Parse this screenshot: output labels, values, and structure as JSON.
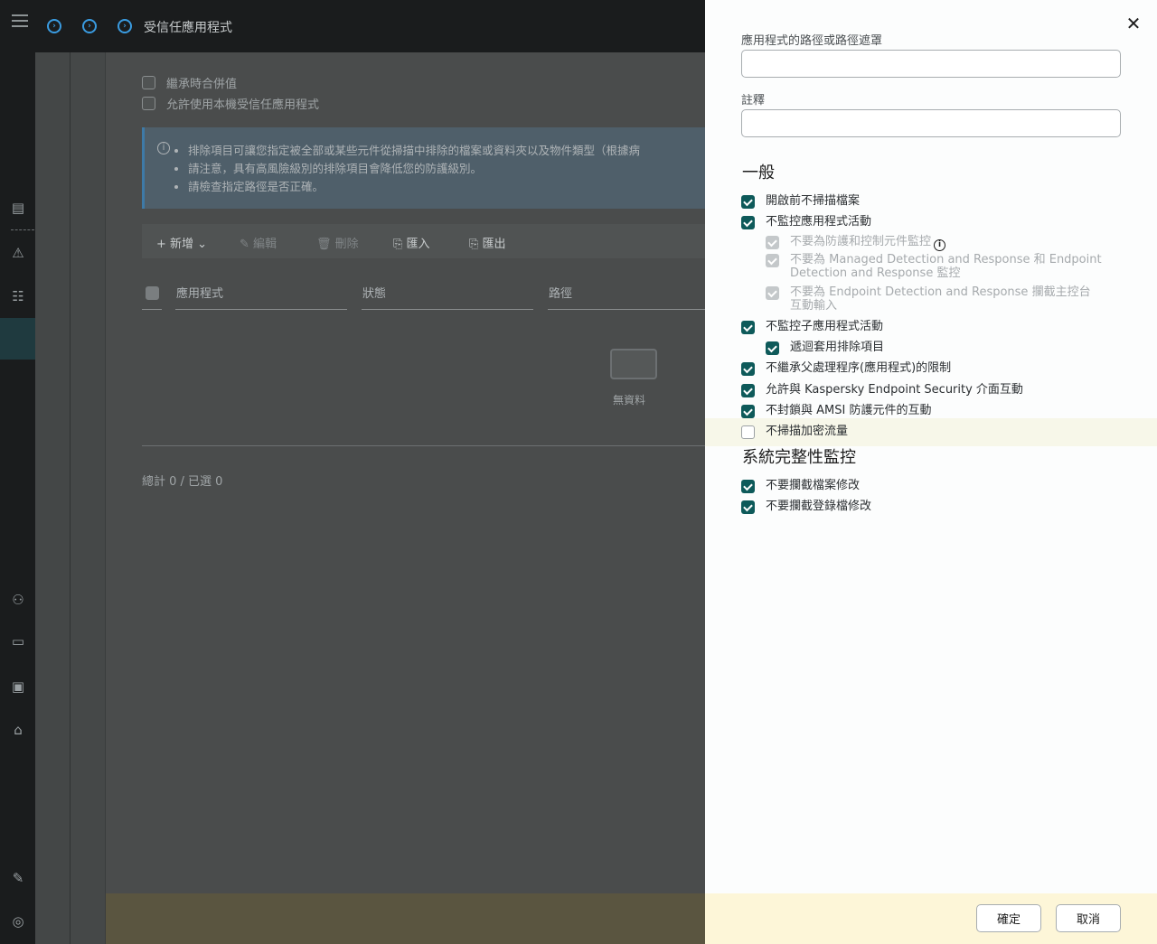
{
  "app": {
    "page_title": "受信任應用程式",
    "options": {
      "inherit": "繼承時合併值",
      "allow_local": "允許使用本機受信任應用程式"
    },
    "info_bullets": [
      "排除項目可讓您指定被全部或某些元件從掃描中排除的檔案或資料夾以及物件類型（根據病",
      "請注意，具有高風險級別的排除項目會降低您的防護級別。",
      "請檢查指定路徑是否正確。"
    ],
    "toolbar": {
      "add": "+ 新增",
      "edit": "編輯",
      "delete": "刪除",
      "import": "匯入",
      "export": "匯出"
    },
    "table": {
      "columns": [
        "應用程式",
        "狀態",
        "路徑"
      ],
      "empty": "無資料"
    },
    "summary": "總計 0 / 已選 0"
  },
  "drawer": {
    "path_label": "應用程式的路徑或路徑遮罩",
    "path_value": "",
    "comment_label": "註釋",
    "comment_value": "",
    "general_title": "一般",
    "general_items": [
      {
        "label": "開啟前不掃描檔案",
        "checked": true
      },
      {
        "label": "不監控應用程式活動",
        "checked": true
      },
      {
        "label": "不要為防護和控制元件監控",
        "checked": true,
        "disabled": true
      },
      {
        "label": "不要為 Managed Detection and Response 和 Endpoint Detection and Response 監控",
        "checked": true,
        "disabled": true
      },
      {
        "label": "不要為 Endpoint Detection and Response 攔截主控台互動輸入",
        "checked": true,
        "disabled": true
      },
      {
        "label": "不監控子應用程式活動",
        "checked": true
      },
      {
        "label": "遞迴套用排除項目",
        "checked": true
      },
      {
        "label": "不繼承父處理程序(應用程式)的限制",
        "checked": true
      },
      {
        "label": "允許與 Kaspersky Endpoint Security 介面互動",
        "checked": true
      },
      {
        "label": "不封鎖與 AMSI 防護元件的互動",
        "checked": true
      },
      {
        "label": "不掃描加密流量",
        "checked": false
      }
    ],
    "integrity_title": "系統完整性監控",
    "integrity_items": [
      {
        "label": "不要攔截檔案修改",
        "checked": true
      },
      {
        "label": "不要攔截登錄檔修改",
        "checked": true
      }
    ],
    "ok": "確定",
    "cancel": "取消"
  },
  "colors": {
    "accent": "#0e5a5a",
    "link_blue": "#3a9be0",
    "footer_bg": "#fdf6d8"
  }
}
